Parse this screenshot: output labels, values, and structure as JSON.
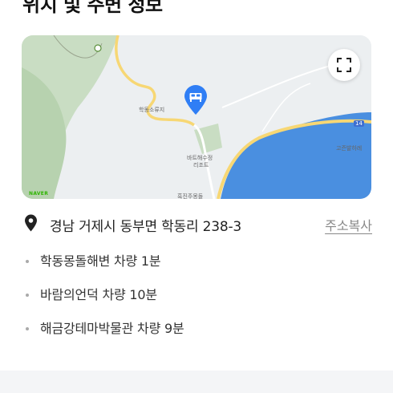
{
  "section": {
    "title": "위치 및 주변 정보"
  },
  "map": {
    "labels": {
      "rest_area": "학동소류지",
      "resort": "바트해수정\n리조트",
      "resort_line1": "바트해수정",
      "resort_line2": "리조트",
      "south": "흑진주몽돌",
      "east": "고즌발하례",
      "road_no": "14",
      "provider": "NAVER"
    },
    "icons": {
      "expand": "expand-icon",
      "pin": "map-pin-bed-icon"
    },
    "colors": {
      "pin": "#2f7ef5",
      "sea": "#4a8fe0",
      "land": "#eceff1",
      "forest": "#c8dcc2",
      "road": "#f7d774"
    }
  },
  "address": {
    "icon": "location-pin-icon",
    "text": "경남 거제시 동부면 학동리 238-3",
    "copy_label": "주소복사"
  },
  "nearby": [
    {
      "text": "학동몽돌해변 차량 1분"
    },
    {
      "text": "바람의언덕 차량 10분"
    },
    {
      "text": "해금강테마박물관 차량 9분"
    }
  ]
}
